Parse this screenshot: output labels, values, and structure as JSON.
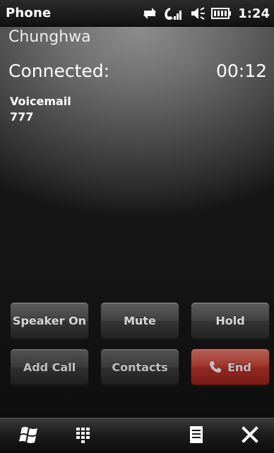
{
  "status_bar": {
    "title": "Phone",
    "time": "1:24",
    "icons": [
      "data-transfer-icon",
      "signal-icon",
      "volume-icon",
      "battery-icon"
    ]
  },
  "call": {
    "carrier": "Chunghwa",
    "status": "Connected:",
    "duration": "00:12",
    "caller_name": "Voicemail",
    "caller_number": "777"
  },
  "buttons": {
    "speaker": "Speaker On",
    "mute": "Mute",
    "hold": "Hold",
    "add_call": "Add Call",
    "contacts": "Contacts",
    "end": "End"
  },
  "bottom_bar": {
    "icons": [
      "windows-start-icon",
      "keypad-icon",
      "menu-icon",
      "close-icon"
    ]
  },
  "colors": {
    "end_button": "#c4362d",
    "button_gray": "#4d4d4d"
  }
}
